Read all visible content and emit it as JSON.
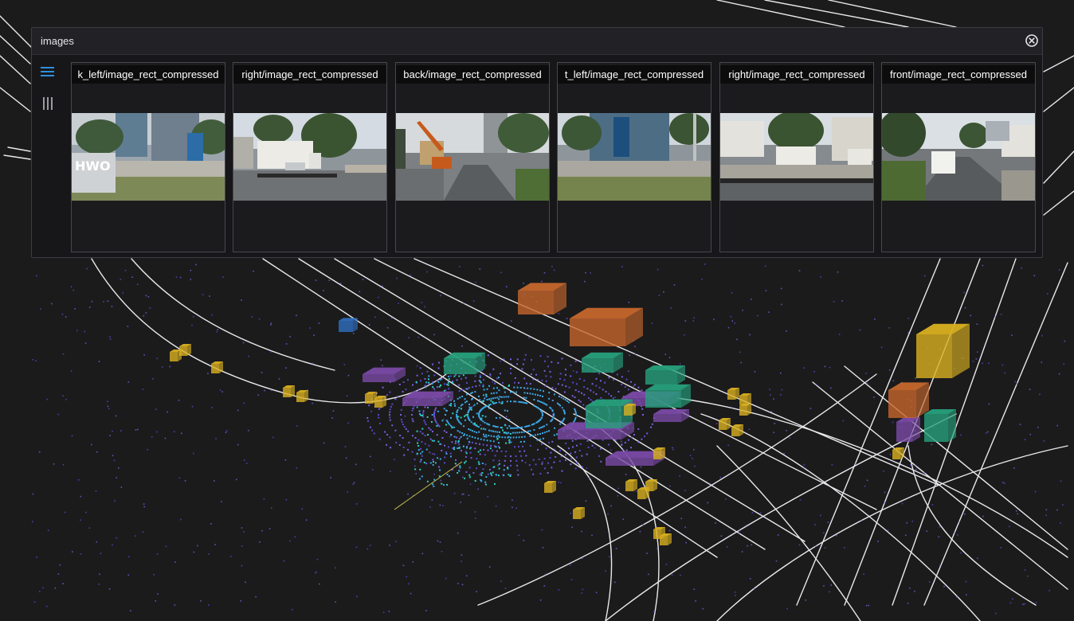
{
  "panel": {
    "title": "images",
    "close_icon": "close-circle-icon"
  },
  "tools": [
    {
      "name": "list-view-icon",
      "active": true,
      "color": "#2f8fdc"
    },
    {
      "name": "column-view-icon",
      "active": false,
      "color": "#9a9aa0"
    }
  ],
  "cameras": [
    {
      "label": "k_left/image_rect_compressed"
    },
    {
      "label": "right/image_rect_compressed"
    },
    {
      "label": "back/image_rect_compressed"
    },
    {
      "label": "t_left/image_rect_compressed"
    },
    {
      "label": "right/image_rect_compressed"
    },
    {
      "label": "front/image_rect_compressed"
    }
  ],
  "colors": {
    "background": "#1b1b1c",
    "lane_lines": "#e9e9ec",
    "vehicle_box": "#c5672d",
    "car_box": "#27a07c",
    "pedestrian_box": "#d9b020",
    "barrier": "#7a4aa6",
    "pointcloud": [
      "#5a47c9",
      "#7c5ce0",
      "#3aa8e6",
      "#2ed1b8"
    ]
  }
}
